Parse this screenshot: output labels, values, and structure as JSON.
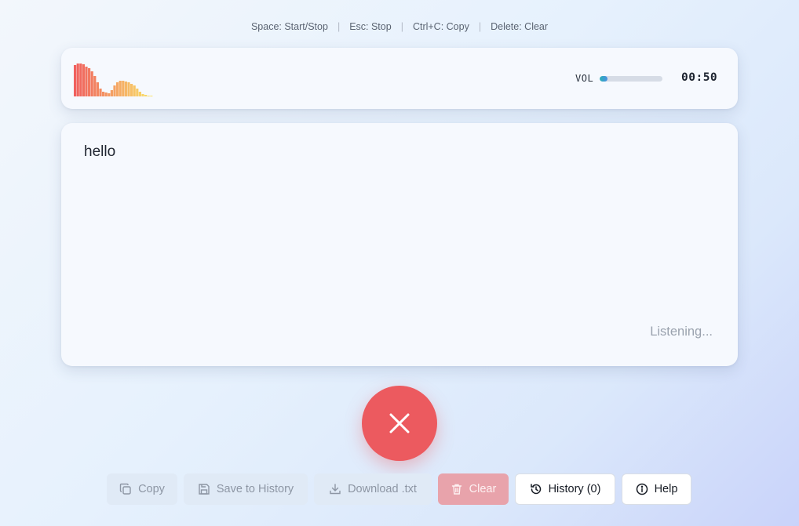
{
  "shortcuts": [
    {
      "label": "Space: Start/Stop"
    },
    {
      "label": "Esc: Stop"
    },
    {
      "label": "Ctrl+C: Copy"
    },
    {
      "label": "Delete: Clear"
    }
  ],
  "meter": {
    "vol_label": "VOL",
    "vol_level": 0.12,
    "timer": "00:50"
  },
  "transcript": {
    "text": "hello",
    "status": "Listening..."
  },
  "record_button": {
    "state": "recording",
    "icon": "close-icon",
    "color": "#ec5a5f"
  },
  "actions": {
    "copy": "Copy",
    "save": "Save to History",
    "download": "Download .txt",
    "clear": "Clear",
    "history": "History (0)",
    "help": "Help"
  },
  "colors": {
    "accent_red": "#ec5a5f",
    "waveform_start": "#f0605e",
    "waveform_end": "#f9e26a"
  }
}
